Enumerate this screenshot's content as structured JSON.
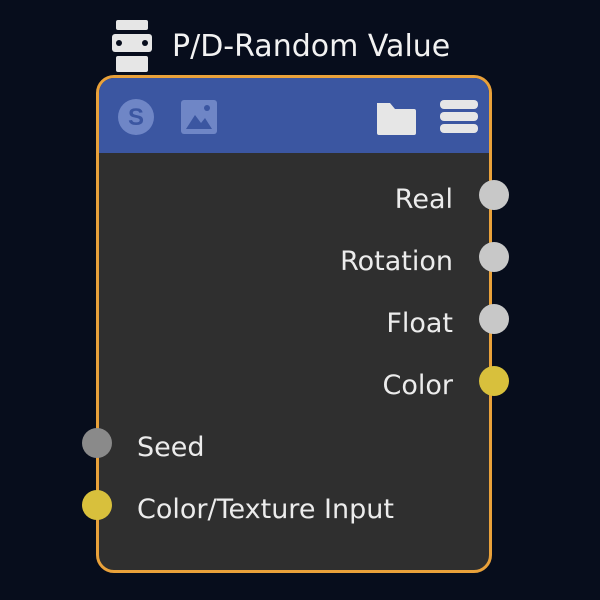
{
  "node": {
    "title": "P/D-Random Value",
    "header_icons": [
      "s-circle-icon",
      "image-icon",
      "folder-icon",
      "menu-icon"
    ],
    "outputs": [
      {
        "label": "Real",
        "port_color": "#c8c8c8"
      },
      {
        "label": "Rotation",
        "port_color": "#c8c8c8"
      },
      {
        "label": "Float",
        "port_color": "#c8c8c8"
      },
      {
        "label": "Color",
        "port_color": "#d8c03c"
      }
    ],
    "inputs": [
      {
        "label": "Seed",
        "port_color": "#8a8a8a"
      },
      {
        "label": "Color/Texture Input",
        "port_color": "#d8c03c"
      }
    ]
  },
  "colors": {
    "background": "#070d1c",
    "node_body": "#2f2f2f",
    "node_header": "#3b56a1",
    "node_border": "#e9a13a",
    "icon_on_header": "#6f86c6"
  }
}
